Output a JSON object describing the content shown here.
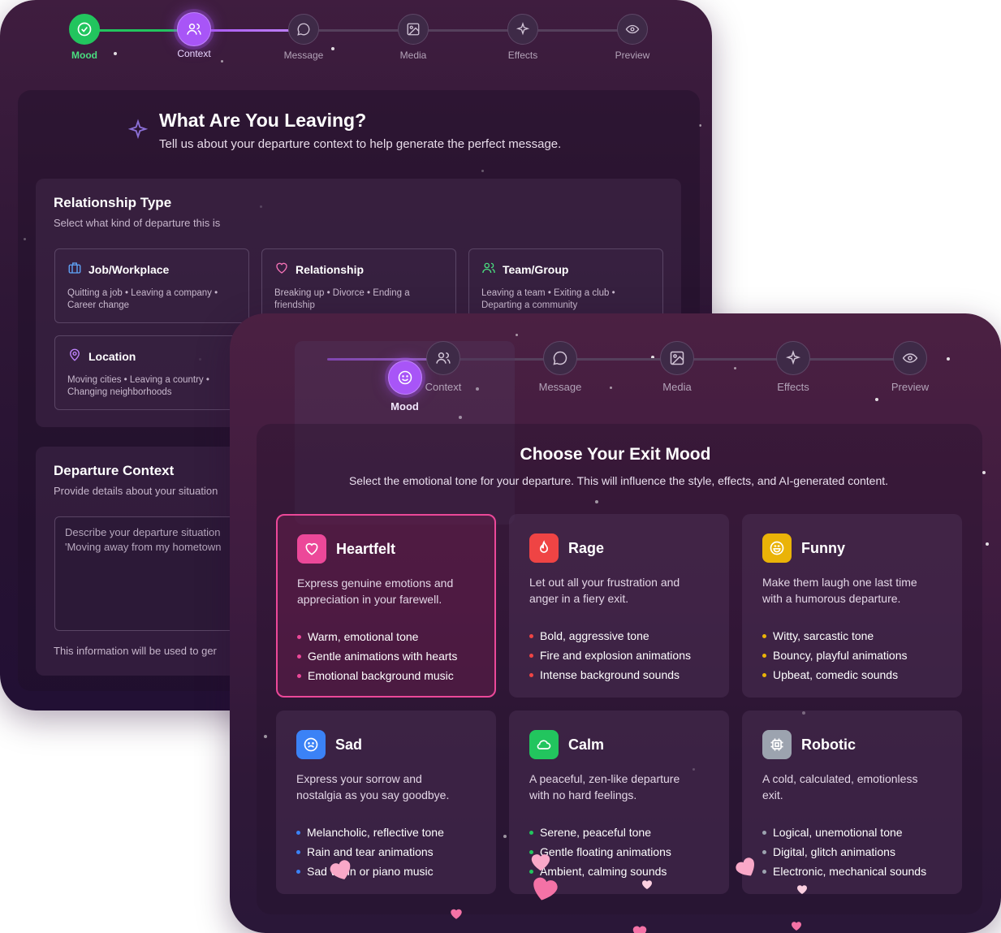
{
  "back_window": {
    "steps": [
      {
        "label": "Mood",
        "icon": "check-icon",
        "state": "done"
      },
      {
        "label": "Context",
        "icon": "users-icon",
        "state": "active"
      },
      {
        "label": "Message",
        "icon": "message-icon",
        "state": "todo"
      },
      {
        "label": "Media",
        "icon": "image-icon",
        "state": "todo"
      },
      {
        "label": "Effects",
        "icon": "sparkles-icon",
        "state": "todo"
      },
      {
        "label": "Preview",
        "icon": "eye-icon",
        "state": "todo"
      }
    ],
    "title": "What Are You Leaving?",
    "subtitle": "Tell us about your departure context to help generate the perfect message.",
    "relationship": {
      "title": "Relationship Type",
      "subtitle": "Select what kind of departure this is",
      "options": [
        {
          "label": "Job/Workplace",
          "icon": "briefcase-icon",
          "desc1": "Quitting a job • Leaving a company •",
          "desc2": "Career change"
        },
        {
          "label": "Relationship",
          "icon": "heart-icon",
          "desc1": "Breaking up • Divorce • Ending a",
          "desc2": "friendship"
        },
        {
          "label": "Team/Group",
          "icon": "users-icon",
          "desc1": "Leaving a team • Exiting a club •",
          "desc2": "Departing a community"
        },
        {
          "label": "Location",
          "icon": "map-pin-icon",
          "desc1": "Moving cities • Leaving a country •",
          "desc2": "Changing neighborhoods"
        }
      ]
    },
    "context": {
      "title": "Departure Context",
      "subtitle": "Provide details about your situation",
      "placeholder_line1": "Describe your departure situation",
      "placeholder_line2": "'Moving away from my hometown",
      "note": "This information will be used to ger"
    }
  },
  "front_window": {
    "steps": [
      {
        "label": "Mood",
        "icon": "smile-icon",
        "state": "active"
      },
      {
        "label": "Context",
        "icon": "users-icon",
        "state": "todo"
      },
      {
        "label": "Message",
        "icon": "message-icon",
        "state": "todo"
      },
      {
        "label": "Media",
        "icon": "image-icon",
        "state": "todo"
      },
      {
        "label": "Effects",
        "icon": "sparkles-icon",
        "state": "todo"
      },
      {
        "label": "Preview",
        "icon": "eye-icon",
        "state": "todo"
      }
    ],
    "title": "Choose Your Exit Mood",
    "subtitle": "Select the emotional tone for your departure. This will influence the style, effects, and AI-generated content.",
    "moods": [
      {
        "name": "Heartfelt",
        "icon": "heart-icon",
        "color": "#ec4899",
        "selected": true,
        "desc1": "Express genuine emotions and",
        "desc2": "appreciation in your farewell.",
        "features": [
          "Warm, emotional tone",
          "Gentle animations with hearts",
          "Emotional background music"
        ]
      },
      {
        "name": "Rage",
        "icon": "flame-icon",
        "color": "#ef4444",
        "selected": false,
        "desc1": "Let out all your frustration and",
        "desc2": "anger in a fiery exit.",
        "features": [
          "Bold, aggressive tone",
          "Fire and explosion animations",
          "Intense background sounds"
        ]
      },
      {
        "name": "Funny",
        "icon": "laugh-icon",
        "color": "#eab308",
        "selected": false,
        "desc1": "Make them laugh one last time",
        "desc2": "with a humorous departure.",
        "features": [
          "Witty, sarcastic tone",
          "Bouncy, playful animations",
          "Upbeat, comedic sounds"
        ]
      },
      {
        "name": "Sad",
        "icon": "frown-icon",
        "color": "#3b82f6",
        "selected": false,
        "desc1": "Express your sorrow and",
        "desc2": "nostalgia as you say goodbye.",
        "features": [
          "Melancholic, reflective tone",
          "Rain and tear animations",
          "Sad violin or piano music"
        ]
      },
      {
        "name": "Calm",
        "icon": "cloud-icon",
        "color": "#22c55e",
        "selected": false,
        "desc1": "A peaceful, zen-like departure",
        "desc2": "with no hard feelings.",
        "features": [
          "Serene, peaceful tone",
          "Gentle floating animations",
          "Ambient, calming sounds"
        ]
      },
      {
        "name": "Robotic",
        "icon": "cpu-icon",
        "color": "#9ca3af",
        "selected": false,
        "desc1": "A cold, calculated, emotionless",
        "desc2": "exit.",
        "features": [
          "Logical, unemotional tone",
          "Digital, glitch animations",
          "Electronic, mechanical sounds"
        ]
      }
    ]
  }
}
